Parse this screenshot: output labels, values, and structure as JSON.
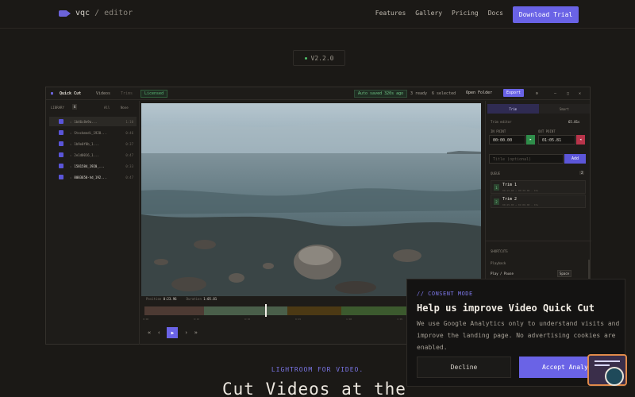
{
  "nav": {
    "brand": "vqc",
    "separator": "/",
    "brand_suffix": "editor",
    "links": [
      "Features",
      "Gallery",
      "Pricing",
      "Docs"
    ],
    "cta": "Download Trial"
  },
  "version": "V2.2.0",
  "editor": {
    "title": "Quick Cut",
    "tab_videos": "Videos",
    "tab_trim": "Trims",
    "license": "Licensed",
    "autosave": "Auto saved 320s ago",
    "ready": "3 ready",
    "selected": "6 selected",
    "open_folder": "Open Folder",
    "export": "Export",
    "library_label": "LIBRARY",
    "library_count": "6",
    "select_all": "All",
    "select_none": "None",
    "files": [
      {
        "name": "1b46c8e9a...",
        "dur": "1:10"
      },
      {
        "name": "Stockmedi_1928...",
        "dur": "0:46"
      },
      {
        "name": "1b9e0f8b_1...",
        "dur": "0:37"
      },
      {
        "name": "2e1d0016_1...",
        "dur": "0:47"
      },
      {
        "name": "1581584_1920_...",
        "dur": "0:33"
      },
      {
        "name": "8083650-hd_192...",
        "dur": "0:47"
      }
    ],
    "position_label": "Position",
    "position_value": "0:23.96",
    "duration_label": "Duration",
    "duration_value": "1:05.81",
    "ticks": [
      "0:00",
      "0:15",
      "0:30",
      "0:45",
      "1:00",
      "1:05"
    ],
    "right": {
      "tab_trim": "Trim",
      "tab_smart": "Smart",
      "trim_section": "Trim editor",
      "trim_length": "65.81s",
      "in_label": "IN POINT",
      "out_label": "OUT POINT",
      "in_value": "00:00.00",
      "out_value": "01:05.81",
      "title_placeholder": "Title (optional)",
      "add": "Add",
      "queue_label": "QUEUE",
      "queue_count": "2",
      "segments": [
        {
          "num": "1",
          "title": "Trim 1",
          "meta": "00:15.00 → 00:30.00 · 15s"
        },
        {
          "num": "2",
          "title": "Trim 2",
          "meta": "00:45.00 → 01:00.00 · 15s"
        }
      ],
      "shortcuts_label": "SHORTCUTS",
      "playback_label": "Playback",
      "play_pause": "Play / Pause",
      "play_key": "Space"
    }
  },
  "consent": {
    "tag": "// CONSENT MODE",
    "title": "Help us improve Video Quick Cut",
    "body": "We use Google Analytics only to understand visits and improve the landing page. No advertising cookies are enabled.",
    "decline": "Decline",
    "accept": "Accept Analytics"
  },
  "hero": {
    "tagline": "LIGHTROOM FOR VIDEO.",
    "headline": "Cut Videos at the"
  },
  "colors": {
    "accent": "#6a63e6",
    "background": "#1b1916",
    "success": "#4fbf6a"
  }
}
